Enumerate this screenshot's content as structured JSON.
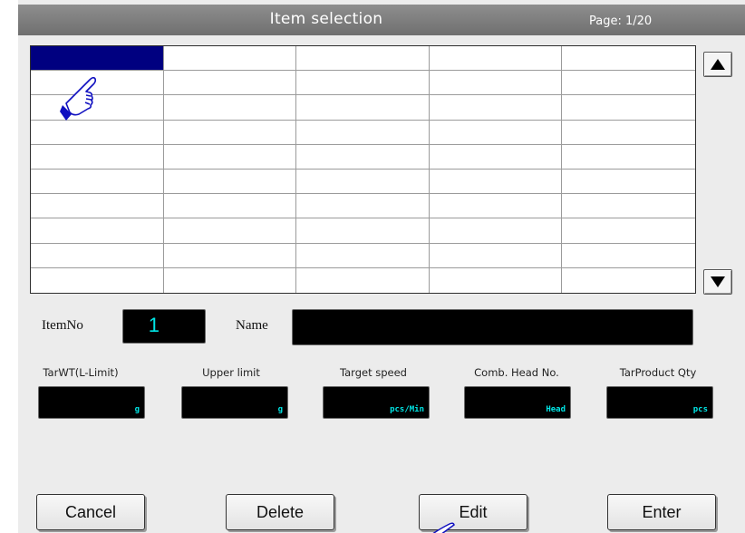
{
  "header": {
    "title": "Item selection",
    "page_label": "Page:",
    "page_value": "1/20"
  },
  "grid": {
    "columns": 5,
    "rows": 10,
    "selected_row": 0,
    "selected_col": 0,
    "selection_color": "#000080"
  },
  "scroll": {
    "up_icon": "triangle-up-icon",
    "down_icon": "triangle-down-icon"
  },
  "item": {
    "itemno_label": "ItemNo",
    "itemno_value": "1",
    "name_label": "Name",
    "name_value": ""
  },
  "params": [
    {
      "label": "TarWT(L-Limit)",
      "unit": "g"
    },
    {
      "label": "Upper limit",
      "unit": "g"
    },
    {
      "label": "Target speed",
      "unit": "pcs/Min"
    },
    {
      "label": "Comb. Head No.",
      "unit": "Head"
    },
    {
      "label": "TarProduct Qty",
      "unit": "pcs"
    }
  ],
  "buttons": {
    "cancel": "Cancel",
    "delete": "Delete",
    "edit": "Edit",
    "enter": "Enter"
  },
  "colors": {
    "display_text": "#00e5e5",
    "title_bar": "#7f7f7f",
    "hand_pointer": "#1010c0"
  }
}
